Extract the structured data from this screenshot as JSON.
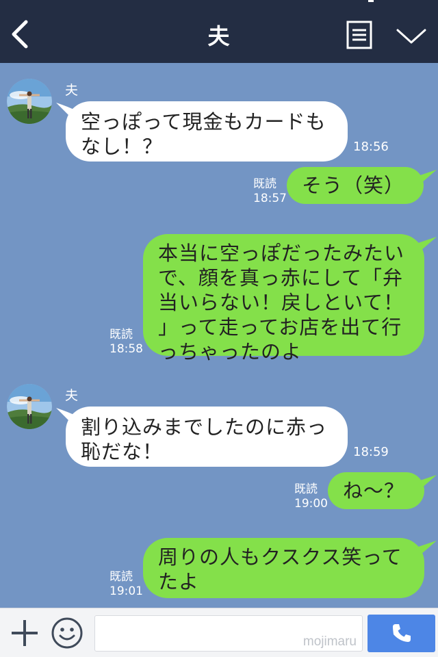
{
  "header": {
    "title": "夫",
    "back_icon": "chevron-left-icon",
    "menu_icon": "notes-icon",
    "collapse_icon": "chevron-down-icon"
  },
  "messages": [
    {
      "direction": "in",
      "sender": "夫",
      "text_lines": [
        "空っぽって現金もカードも",
        "なし！？"
      ],
      "time": "18:56"
    },
    {
      "direction": "out",
      "read": "既読",
      "text_lines": [
        "そう（笑）"
      ],
      "time": "18:57"
    },
    {
      "direction": "out",
      "read": "既読",
      "text_lines": [
        "本当に空っぽだったみたい",
        "で、顔を真っ赤にして「弁",
        "当いらない！戻しといて！",
        "」って走ってお店を出て行",
        "っちゃったのよ"
      ],
      "time": "18:58"
    },
    {
      "direction": "in",
      "sender": "夫",
      "text_lines": [
        "割り込みまでしたのに赤っ",
        "恥だな！"
      ],
      "time": "18:59"
    },
    {
      "direction": "out",
      "read": "既読",
      "text_lines": [
        "ね〜？"
      ],
      "time": "19:00"
    },
    {
      "direction": "out",
      "read": "既読",
      "text_lines": [
        "周りの人もクスクス笑って",
        "たよ"
      ],
      "time": "19:01"
    }
  ],
  "footer": {
    "input_placeholder": "",
    "input_value": "",
    "watermark": "mojimaru",
    "plus_icon": "plus-icon",
    "sticker_icon": "smiley-icon",
    "call_icon": "phone-icon"
  },
  "colors": {
    "header_bg": "#232d43",
    "chat_bg": "#7395c4",
    "incoming_bubble": "#ffffff",
    "outgoing_bubble": "#84e04a",
    "call_button": "#4d86e6"
  }
}
